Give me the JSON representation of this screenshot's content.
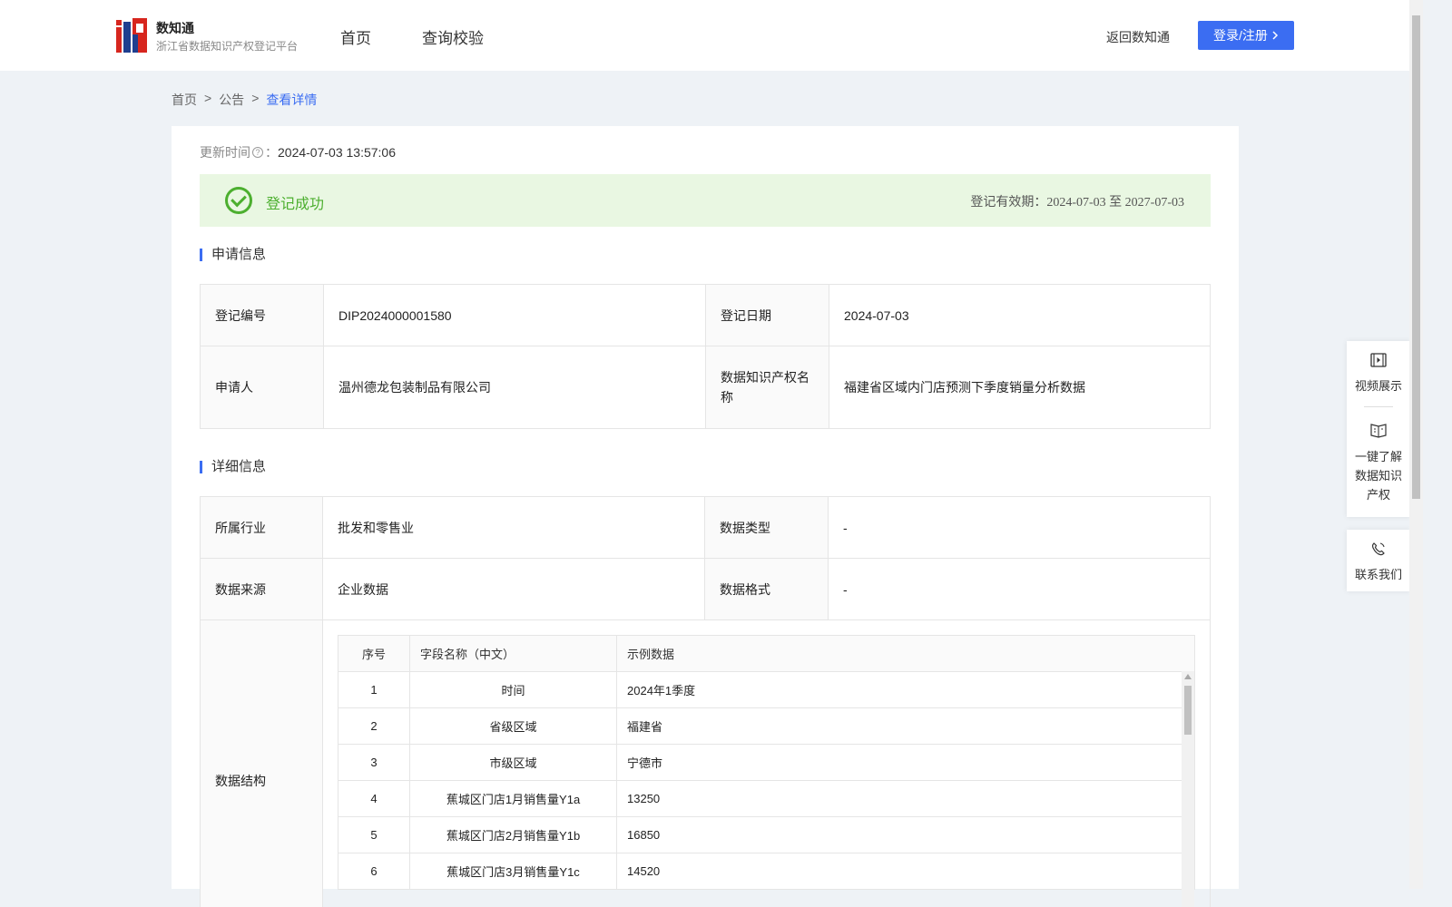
{
  "header": {
    "brand_name": "数知通",
    "brand_sub": "浙江省数据知识产权登记平台",
    "nav": [
      "首页",
      "查询校验"
    ],
    "back_link": "返回数知通",
    "login_label": "登录/注册",
    "accent": "#3b6df2"
  },
  "breadcrumb": [
    "首页",
    "公告",
    "查看详情"
  ],
  "breadcrumb_sep": ">",
  "update": {
    "label": "更新时间",
    "colon": "：",
    "value": "2024-07-03 13:57:06"
  },
  "status": {
    "text": "登记成功",
    "validity_label": "登记有效期：",
    "validity_value": "2024-07-03 至 2027-07-03",
    "color": "#4caf2f"
  },
  "section_apply": {
    "title": "申请信息",
    "rows": [
      {
        "k1": "登记编号",
        "v1": "DIP2024000001580",
        "k2": "登记日期",
        "v2": "2024-07-03"
      },
      {
        "k1": "申请人",
        "v1": "温州德龙包装制品有限公司",
        "k2": "数据知识产权名称",
        "v2": "福建省区域内门店预测下季度销量分析数据"
      }
    ]
  },
  "section_detail": {
    "title": "详细信息",
    "rows": [
      {
        "k1": "所属行业",
        "v1": "批发和零售业",
        "k2": "数据类型",
        "v2": "-"
      },
      {
        "k1": "数据来源",
        "v1": "企业数据",
        "k2": "数据格式",
        "v2": "-"
      }
    ],
    "structure_label": "数据结构",
    "structure": {
      "headers": [
        "序号",
        "字段名称（中文）",
        "示例数据"
      ],
      "rows": [
        [
          "1",
          "时间",
          "2024年1季度"
        ],
        [
          "2",
          "省级区域",
          "福建省"
        ],
        [
          "3",
          "市级区域",
          "宁德市"
        ],
        [
          "4",
          "蕉城区门店1月销售量Y1a",
          "13250"
        ],
        [
          "5",
          "蕉城区门店2月销售量Y1b",
          "16850"
        ],
        [
          "6",
          "蕉城区门店3月销售量Y1c",
          "14520"
        ]
      ]
    }
  },
  "float": {
    "video": "视频展示",
    "learn": [
      "一键了解",
      "数据知识",
      "产权"
    ],
    "contact": "联系我们"
  }
}
